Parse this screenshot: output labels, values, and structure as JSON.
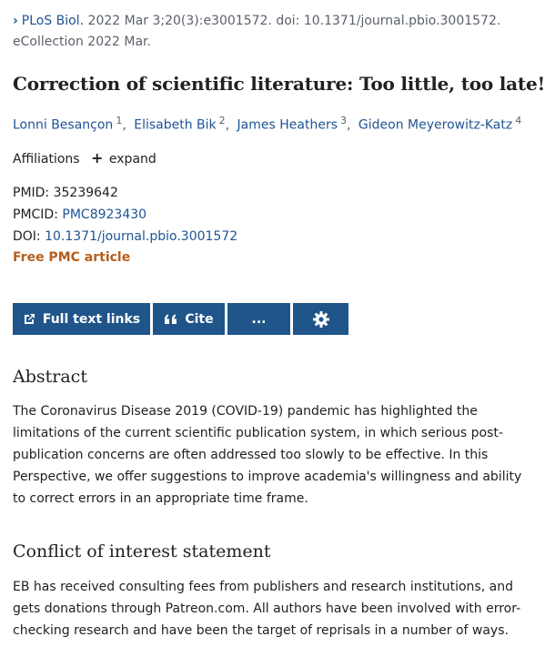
{
  "citation": {
    "journal": "PLoS Biol.",
    "details": " 2022 Mar 3;20(3):e3001572. doi: 10.1371/journal.pbio.3001572.",
    "ecollection": "eCollection 2022 Mar."
  },
  "title": "Correction of scientific literature: Too little, too late!",
  "authors": [
    {
      "name": "Lonni Besançon",
      "sup": "1"
    },
    {
      "name": "Elisabeth Bik",
      "sup": "2"
    },
    {
      "name": "James Heathers",
      "sup": "3"
    },
    {
      "name": "Gideon Meyerowitz-Katz",
      "sup": "4"
    }
  ],
  "affiliations": {
    "label": "Affiliations",
    "expand_label": "expand"
  },
  "ids": {
    "pmid_label": "PMID:",
    "pmid_value": "35239642",
    "pmcid_label": "PMCID:",
    "pmcid_value": "PMC8923430",
    "doi_label": "DOI:",
    "doi_value": "10.1371/journal.pbio.3001572"
  },
  "free_pmc": "Free PMC article",
  "actions": {
    "full_text_label": "Full text links",
    "cite_label": "Cite",
    "more_label": "...",
    "settings_icon": "gear-icon"
  },
  "abstract": {
    "heading": "Abstract",
    "text": "The Coronavirus Disease 2019 (COVID-19) pandemic has highlighted the limitations of the current scientific publication system, in which serious post-publication concerns are often addressed too slowly to be effective. In this Perspective, we offer suggestions to improve academia's willingness and ability to correct errors in an appropriate time frame."
  },
  "coi": {
    "heading": "Conflict of interest statement",
    "text": "EB has received consulting fees from publishers and research institutions, and gets donations through Patreon.com. All authors have been involved with error-checking research and have been the target of reprisals in a number of ways."
  },
  "colors": {
    "link": "#205493",
    "button": "#20558a",
    "free_pmc": "#b65e1c"
  }
}
